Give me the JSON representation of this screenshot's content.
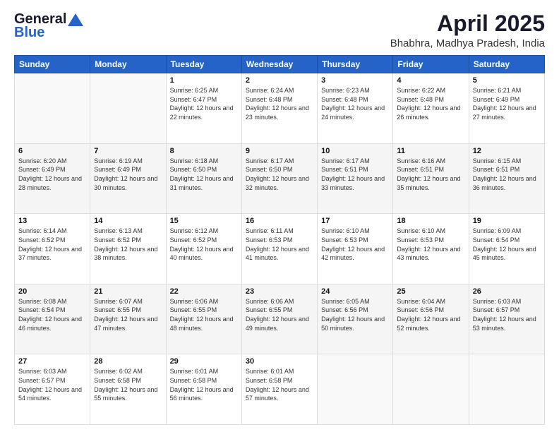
{
  "logo": {
    "line1": "General",
    "line2": "Blue"
  },
  "title": "April 2025",
  "location": "Bhabhra, Madhya Pradesh, India",
  "days_header": [
    "Sunday",
    "Monday",
    "Tuesday",
    "Wednesday",
    "Thursday",
    "Friday",
    "Saturday"
  ],
  "weeks": [
    [
      {
        "day": "",
        "sunrise": "",
        "sunset": "",
        "daylight": ""
      },
      {
        "day": "",
        "sunrise": "",
        "sunset": "",
        "daylight": ""
      },
      {
        "day": "1",
        "sunrise": "Sunrise: 6:25 AM",
        "sunset": "Sunset: 6:47 PM",
        "daylight": "Daylight: 12 hours and 22 minutes."
      },
      {
        "day": "2",
        "sunrise": "Sunrise: 6:24 AM",
        "sunset": "Sunset: 6:48 PM",
        "daylight": "Daylight: 12 hours and 23 minutes."
      },
      {
        "day": "3",
        "sunrise": "Sunrise: 6:23 AM",
        "sunset": "Sunset: 6:48 PM",
        "daylight": "Daylight: 12 hours and 24 minutes."
      },
      {
        "day": "4",
        "sunrise": "Sunrise: 6:22 AM",
        "sunset": "Sunset: 6:48 PM",
        "daylight": "Daylight: 12 hours and 26 minutes."
      },
      {
        "day": "5",
        "sunrise": "Sunrise: 6:21 AM",
        "sunset": "Sunset: 6:49 PM",
        "daylight": "Daylight: 12 hours and 27 minutes."
      }
    ],
    [
      {
        "day": "6",
        "sunrise": "Sunrise: 6:20 AM",
        "sunset": "Sunset: 6:49 PM",
        "daylight": "Daylight: 12 hours and 28 minutes."
      },
      {
        "day": "7",
        "sunrise": "Sunrise: 6:19 AM",
        "sunset": "Sunset: 6:49 PM",
        "daylight": "Daylight: 12 hours and 30 minutes."
      },
      {
        "day": "8",
        "sunrise": "Sunrise: 6:18 AM",
        "sunset": "Sunset: 6:50 PM",
        "daylight": "Daylight: 12 hours and 31 minutes."
      },
      {
        "day": "9",
        "sunrise": "Sunrise: 6:17 AM",
        "sunset": "Sunset: 6:50 PM",
        "daylight": "Daylight: 12 hours and 32 minutes."
      },
      {
        "day": "10",
        "sunrise": "Sunrise: 6:17 AM",
        "sunset": "Sunset: 6:51 PM",
        "daylight": "Daylight: 12 hours and 33 minutes."
      },
      {
        "day": "11",
        "sunrise": "Sunrise: 6:16 AM",
        "sunset": "Sunset: 6:51 PM",
        "daylight": "Daylight: 12 hours and 35 minutes."
      },
      {
        "day": "12",
        "sunrise": "Sunrise: 6:15 AM",
        "sunset": "Sunset: 6:51 PM",
        "daylight": "Daylight: 12 hours and 36 minutes."
      }
    ],
    [
      {
        "day": "13",
        "sunrise": "Sunrise: 6:14 AM",
        "sunset": "Sunset: 6:52 PM",
        "daylight": "Daylight: 12 hours and 37 minutes."
      },
      {
        "day": "14",
        "sunrise": "Sunrise: 6:13 AM",
        "sunset": "Sunset: 6:52 PM",
        "daylight": "Daylight: 12 hours and 38 minutes."
      },
      {
        "day": "15",
        "sunrise": "Sunrise: 6:12 AM",
        "sunset": "Sunset: 6:52 PM",
        "daylight": "Daylight: 12 hours and 40 minutes."
      },
      {
        "day": "16",
        "sunrise": "Sunrise: 6:11 AM",
        "sunset": "Sunset: 6:53 PM",
        "daylight": "Daylight: 12 hours and 41 minutes."
      },
      {
        "day": "17",
        "sunrise": "Sunrise: 6:10 AM",
        "sunset": "Sunset: 6:53 PM",
        "daylight": "Daylight: 12 hours and 42 minutes."
      },
      {
        "day": "18",
        "sunrise": "Sunrise: 6:10 AM",
        "sunset": "Sunset: 6:53 PM",
        "daylight": "Daylight: 12 hours and 43 minutes."
      },
      {
        "day": "19",
        "sunrise": "Sunrise: 6:09 AM",
        "sunset": "Sunset: 6:54 PM",
        "daylight": "Daylight: 12 hours and 45 minutes."
      }
    ],
    [
      {
        "day": "20",
        "sunrise": "Sunrise: 6:08 AM",
        "sunset": "Sunset: 6:54 PM",
        "daylight": "Daylight: 12 hours and 46 minutes."
      },
      {
        "day": "21",
        "sunrise": "Sunrise: 6:07 AM",
        "sunset": "Sunset: 6:55 PM",
        "daylight": "Daylight: 12 hours and 47 minutes."
      },
      {
        "day": "22",
        "sunrise": "Sunrise: 6:06 AM",
        "sunset": "Sunset: 6:55 PM",
        "daylight": "Daylight: 12 hours and 48 minutes."
      },
      {
        "day": "23",
        "sunrise": "Sunrise: 6:06 AM",
        "sunset": "Sunset: 6:55 PM",
        "daylight": "Daylight: 12 hours and 49 minutes."
      },
      {
        "day": "24",
        "sunrise": "Sunrise: 6:05 AM",
        "sunset": "Sunset: 6:56 PM",
        "daylight": "Daylight: 12 hours and 50 minutes."
      },
      {
        "day": "25",
        "sunrise": "Sunrise: 6:04 AM",
        "sunset": "Sunset: 6:56 PM",
        "daylight": "Daylight: 12 hours and 52 minutes."
      },
      {
        "day": "26",
        "sunrise": "Sunrise: 6:03 AM",
        "sunset": "Sunset: 6:57 PM",
        "daylight": "Daylight: 12 hours and 53 minutes."
      }
    ],
    [
      {
        "day": "27",
        "sunrise": "Sunrise: 6:03 AM",
        "sunset": "Sunset: 6:57 PM",
        "daylight": "Daylight: 12 hours and 54 minutes."
      },
      {
        "day": "28",
        "sunrise": "Sunrise: 6:02 AM",
        "sunset": "Sunset: 6:58 PM",
        "daylight": "Daylight: 12 hours and 55 minutes."
      },
      {
        "day": "29",
        "sunrise": "Sunrise: 6:01 AM",
        "sunset": "Sunset: 6:58 PM",
        "daylight": "Daylight: 12 hours and 56 minutes."
      },
      {
        "day": "30",
        "sunrise": "Sunrise: 6:01 AM",
        "sunset": "Sunset: 6:58 PM",
        "daylight": "Daylight: 12 hours and 57 minutes."
      },
      {
        "day": "",
        "sunrise": "",
        "sunset": "",
        "daylight": ""
      },
      {
        "day": "",
        "sunrise": "",
        "sunset": "",
        "daylight": ""
      },
      {
        "day": "",
        "sunrise": "",
        "sunset": "",
        "daylight": ""
      }
    ]
  ]
}
